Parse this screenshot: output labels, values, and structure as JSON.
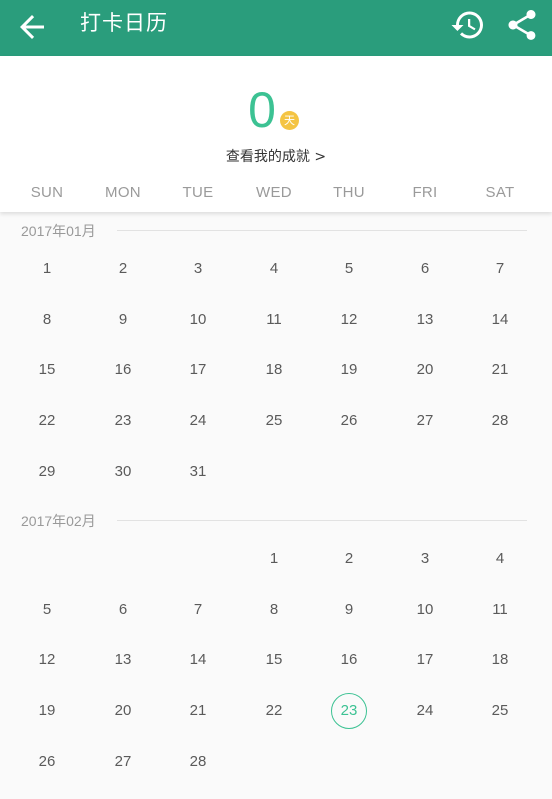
{
  "header": {
    "title": "打卡日历",
    "back_icon": "arrow-back-icon",
    "history_icon": "history-icon",
    "share_icon": "share-icon",
    "color": "#2a9d7c"
  },
  "summary": {
    "count": "0",
    "unit": "天",
    "achievements_link": "查看我的成就 >"
  },
  "weekdays": [
    "SUN",
    "MON",
    "TUE",
    "WED",
    "THU",
    "FRI",
    "SAT"
  ],
  "months": [
    {
      "label": "2017年01月",
      "weeks": [
        [
          "1",
          "2",
          "3",
          "4",
          "5",
          "6",
          "7"
        ],
        [
          "8",
          "9",
          "10",
          "11",
          "12",
          "13",
          "14"
        ],
        [
          "15",
          "16",
          "17",
          "18",
          "19",
          "20",
          "21"
        ],
        [
          "22",
          "23",
          "24",
          "25",
          "26",
          "27",
          "28"
        ],
        [
          "29",
          "30",
          "31",
          "",
          "",
          "",
          ""
        ]
      ]
    },
    {
      "label": "2017年02月",
      "weeks": [
        [
          "",
          "",
          "",
          "1",
          "2",
          "3",
          "4"
        ],
        [
          "5",
          "6",
          "7",
          "8",
          "9",
          "10",
          "11"
        ],
        [
          "12",
          "13",
          "14",
          "15",
          "16",
          "17",
          "18"
        ],
        [
          "19",
          "20",
          "21",
          "22",
          "23",
          "24",
          "25"
        ],
        [
          "26",
          "27",
          "28",
          "",
          "",
          "",
          ""
        ]
      ]
    }
  ],
  "today": {
    "month": "2017年02月",
    "day": "23"
  },
  "accent_color": "#3cc293"
}
